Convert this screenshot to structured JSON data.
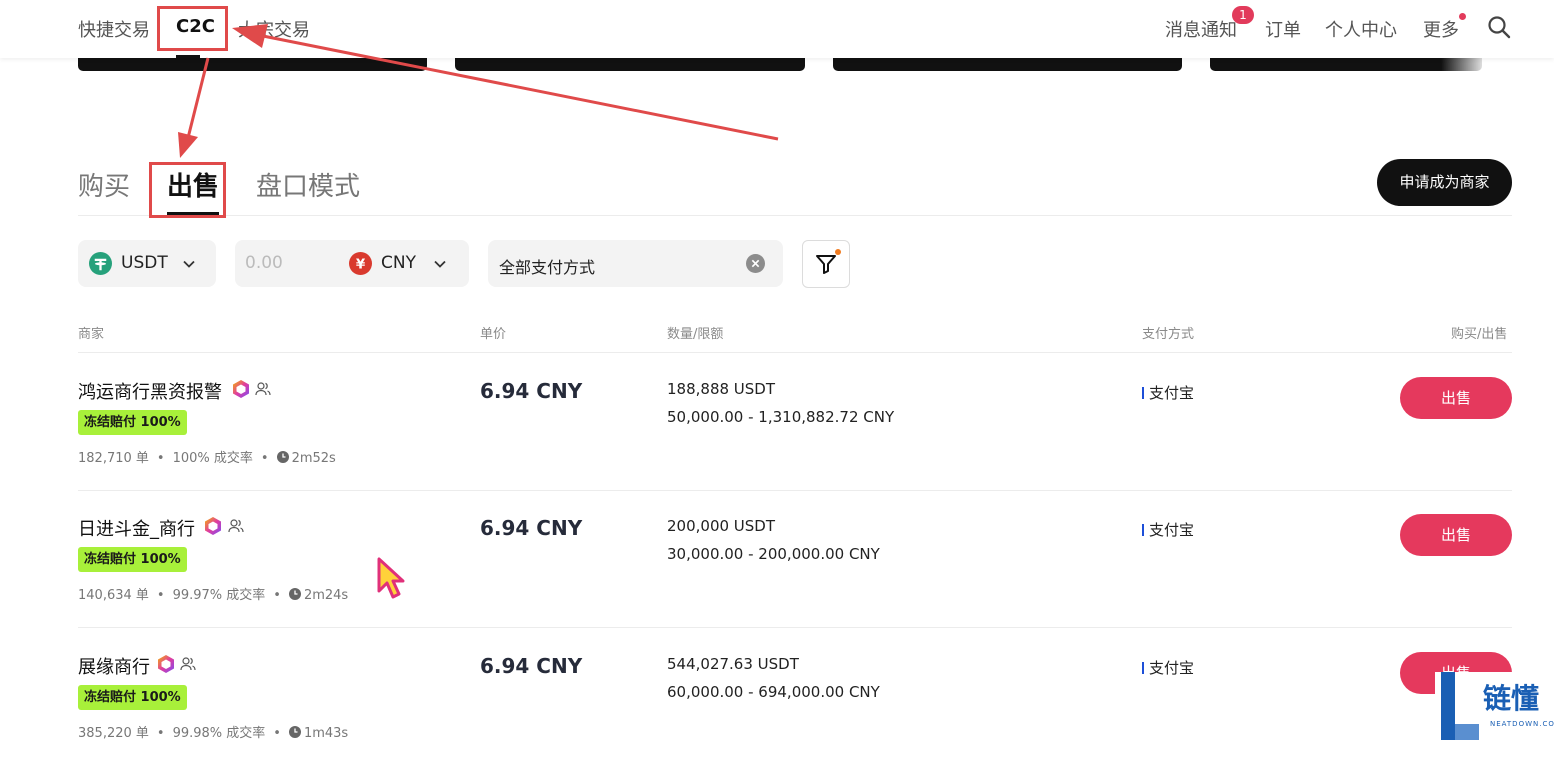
{
  "topnav": {
    "items": [
      "快捷交易",
      "C2C",
      "大宗交易"
    ],
    "right": {
      "notifications": "消息通知",
      "notification_count": "1",
      "orders": "订单",
      "profile": "个人中心",
      "more": "更多"
    }
  },
  "tabs": [
    "购买",
    "出售",
    "盘口模式"
  ],
  "apply_merchant": "申请成为商家",
  "filters": {
    "coin": "USDT",
    "amount_placeholder": "0.00",
    "fiat": "CNY",
    "fiat_symbol": "¥",
    "payment": "全部支付方式"
  },
  "table": {
    "headers": [
      "商家",
      "单价",
      "数量/限额",
      "支付方式",
      "购买/出售"
    ],
    "rows": [
      {
        "merchant": "鸿运商行黑资报警",
        "tag": "冻结赔付 100%",
        "orders": "182,710 单",
        "rate": "100% 成交率",
        "time": "2m52s",
        "price": "6.94 CNY",
        "quantity": "188,888 USDT",
        "limit": "50,000.00 - 1,310,882.72 CNY",
        "payment": "支付宝",
        "action": "出售"
      },
      {
        "merchant": "日进斗金_商行",
        "tag": "冻结赔付 100%",
        "orders": "140,634 单",
        "rate": "99.97% 成交率",
        "time": "2m24s",
        "price": "6.94 CNY",
        "quantity": "200,000 USDT",
        "limit": "30,000.00 - 200,000.00 CNY",
        "payment": "支付宝",
        "action": "出售"
      },
      {
        "merchant": "展缘商行",
        "tag": "冻结赔付 100%",
        "orders": "385,220 单",
        "rate": "99.98% 成交率",
        "time": "1m43s",
        "price": "6.94 CNY",
        "quantity": "544,027.63 USDT",
        "limit": "60,000.00 - 694,000.00 CNY",
        "payment": "支付宝",
        "action": "出售"
      }
    ]
  },
  "watermark": {
    "text": "链懂",
    "sub": "NEATDOWN.COM"
  },
  "colors": {
    "sell_button": "#e5395d",
    "tag_bg": "#a8f03a",
    "annotation": "#e04a4a",
    "badge": "#e23b5b"
  }
}
